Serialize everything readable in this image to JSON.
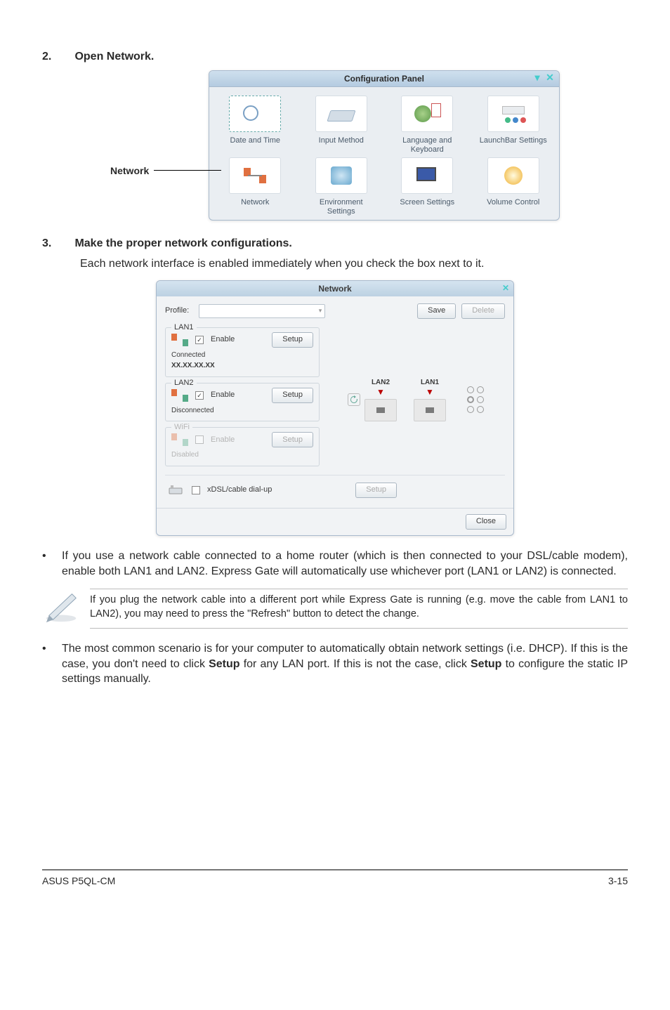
{
  "step2": {
    "num": "2.",
    "title": "Open Network."
  },
  "panel": {
    "title": "Configuration Panel",
    "items": [
      {
        "label": "Date and Time"
      },
      {
        "label": "Input Method"
      },
      {
        "label": "Language and\nKeyboard"
      },
      {
        "label": "LaunchBar Settings"
      },
      {
        "label": "Network"
      },
      {
        "label": "Environment\nSettings"
      },
      {
        "label": "Screen Settings"
      },
      {
        "label": "Volume Control"
      }
    ],
    "pointer_label": "Network"
  },
  "step3": {
    "num": "3.",
    "title": "Make the proper network configurations.",
    "body": "Each network interface is enabled immediately when you check the box next to it."
  },
  "netdlg": {
    "title": "Network",
    "profile_label": "Profile:",
    "save": "Save",
    "delete": "Delete",
    "lan1": {
      "legend": "LAN1",
      "enable": "Enable",
      "setup": "Setup",
      "status": "Connected",
      "ip": "XX.XX.XX.XX"
    },
    "lan2": {
      "legend": "LAN2",
      "enable": "Enable",
      "setup": "Setup",
      "status": "Disconnected"
    },
    "wifi": {
      "legend": "WiFi",
      "enable": "Enable",
      "setup": "Setup",
      "status": "Disabled"
    },
    "ports": {
      "lan2": "LAN2",
      "lan1": "LAN1"
    },
    "xdsl": {
      "label": "xDSL/cable dial-up",
      "setup": "Setup"
    },
    "close": "Close"
  },
  "bullet1": "If you use a network cable connected to a home router (which is then connected to your DSL/cable modem), enable both LAN1 and LAN2. Express Gate  will automatically use whichever port (LAN1 or LAN2) is connected.",
  "note": "If you plug the network cable into a different port while Express Gate  is running (e.g. move the cable from LAN1 to LAN2), you may need to press the \"Refresh\" button to detect the change.",
  "bullet2_pre": "The most common scenario is for your computer to automatically obtain network settings (i.e. DHCP). If this is the case, you don't need to click ",
  "bullet2_b1": "Setup",
  "bullet2_mid": " for any LAN port. If this is not the case, click ",
  "bullet2_b2": "Setup",
  "bullet2_post": " to configure the static IP settings manually.",
  "footer": {
    "left": "ASUS P5QL-CM",
    "right": "3-15"
  }
}
